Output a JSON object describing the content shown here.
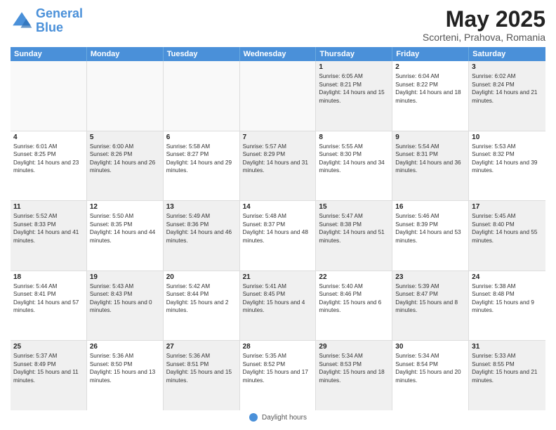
{
  "header": {
    "logo_general": "General",
    "logo_blue": "Blue",
    "title": "May 2025",
    "subtitle": "Scorteni, Prahova, Romania"
  },
  "days_of_week": [
    "Sunday",
    "Monday",
    "Tuesday",
    "Wednesday",
    "Thursday",
    "Friday",
    "Saturday"
  ],
  "weeks": [
    [
      {
        "day": "",
        "empty": true
      },
      {
        "day": "",
        "empty": true
      },
      {
        "day": "",
        "empty": true
      },
      {
        "day": "",
        "empty": true
      },
      {
        "day": "1",
        "sunrise": "6:05 AM",
        "sunset": "8:21 PM",
        "daylight": "14 hours and 15 minutes."
      },
      {
        "day": "2",
        "sunrise": "6:04 AM",
        "sunset": "8:22 PM",
        "daylight": "14 hours and 18 minutes."
      },
      {
        "day": "3",
        "sunrise": "6:02 AM",
        "sunset": "8:24 PM",
        "daylight": "14 hours and 21 minutes."
      }
    ],
    [
      {
        "day": "4",
        "sunrise": "6:01 AM",
        "sunset": "8:25 PM",
        "daylight": "14 hours and 23 minutes."
      },
      {
        "day": "5",
        "sunrise": "6:00 AM",
        "sunset": "8:26 PM",
        "daylight": "14 hours and 26 minutes."
      },
      {
        "day": "6",
        "sunrise": "5:58 AM",
        "sunset": "8:27 PM",
        "daylight": "14 hours and 29 minutes."
      },
      {
        "day": "7",
        "sunrise": "5:57 AM",
        "sunset": "8:29 PM",
        "daylight": "14 hours and 31 minutes."
      },
      {
        "day": "8",
        "sunrise": "5:55 AM",
        "sunset": "8:30 PM",
        "daylight": "14 hours and 34 minutes."
      },
      {
        "day": "9",
        "sunrise": "5:54 AM",
        "sunset": "8:31 PM",
        "daylight": "14 hours and 36 minutes."
      },
      {
        "day": "10",
        "sunrise": "5:53 AM",
        "sunset": "8:32 PM",
        "daylight": "14 hours and 39 minutes."
      }
    ],
    [
      {
        "day": "11",
        "sunrise": "5:52 AM",
        "sunset": "8:33 PM",
        "daylight": "14 hours and 41 minutes."
      },
      {
        "day": "12",
        "sunrise": "5:50 AM",
        "sunset": "8:35 PM",
        "daylight": "14 hours and 44 minutes."
      },
      {
        "day": "13",
        "sunrise": "5:49 AM",
        "sunset": "8:36 PM",
        "daylight": "14 hours and 46 minutes."
      },
      {
        "day": "14",
        "sunrise": "5:48 AM",
        "sunset": "8:37 PM",
        "daylight": "14 hours and 48 minutes."
      },
      {
        "day": "15",
        "sunrise": "5:47 AM",
        "sunset": "8:38 PM",
        "daylight": "14 hours and 51 minutes."
      },
      {
        "day": "16",
        "sunrise": "5:46 AM",
        "sunset": "8:39 PM",
        "daylight": "14 hours and 53 minutes."
      },
      {
        "day": "17",
        "sunrise": "5:45 AM",
        "sunset": "8:40 PM",
        "daylight": "14 hours and 55 minutes."
      }
    ],
    [
      {
        "day": "18",
        "sunrise": "5:44 AM",
        "sunset": "8:41 PM",
        "daylight": "14 hours and 57 minutes."
      },
      {
        "day": "19",
        "sunrise": "5:43 AM",
        "sunset": "8:43 PM",
        "daylight": "15 hours and 0 minutes."
      },
      {
        "day": "20",
        "sunrise": "5:42 AM",
        "sunset": "8:44 PM",
        "daylight": "15 hours and 2 minutes."
      },
      {
        "day": "21",
        "sunrise": "5:41 AM",
        "sunset": "8:45 PM",
        "daylight": "15 hours and 4 minutes."
      },
      {
        "day": "22",
        "sunrise": "5:40 AM",
        "sunset": "8:46 PM",
        "daylight": "15 hours and 6 minutes."
      },
      {
        "day": "23",
        "sunrise": "5:39 AM",
        "sunset": "8:47 PM",
        "daylight": "15 hours and 8 minutes."
      },
      {
        "day": "24",
        "sunrise": "5:38 AM",
        "sunset": "8:48 PM",
        "daylight": "15 hours and 9 minutes."
      }
    ],
    [
      {
        "day": "25",
        "sunrise": "5:37 AM",
        "sunset": "8:49 PM",
        "daylight": "15 hours and 11 minutes."
      },
      {
        "day": "26",
        "sunrise": "5:36 AM",
        "sunset": "8:50 PM",
        "daylight": "15 hours and 13 minutes."
      },
      {
        "day": "27",
        "sunrise": "5:36 AM",
        "sunset": "8:51 PM",
        "daylight": "15 hours and 15 minutes."
      },
      {
        "day": "28",
        "sunrise": "5:35 AM",
        "sunset": "8:52 PM",
        "daylight": "15 hours and 17 minutes."
      },
      {
        "day": "29",
        "sunrise": "5:34 AM",
        "sunset": "8:53 PM",
        "daylight": "15 hours and 18 minutes."
      },
      {
        "day": "30",
        "sunrise": "5:34 AM",
        "sunset": "8:54 PM",
        "daylight": "15 hours and 20 minutes."
      },
      {
        "day": "31",
        "sunrise": "5:33 AM",
        "sunset": "8:55 PM",
        "daylight": "15 hours and 21 minutes."
      }
    ]
  ],
  "footer": {
    "daylight_label": "Daylight hours"
  }
}
